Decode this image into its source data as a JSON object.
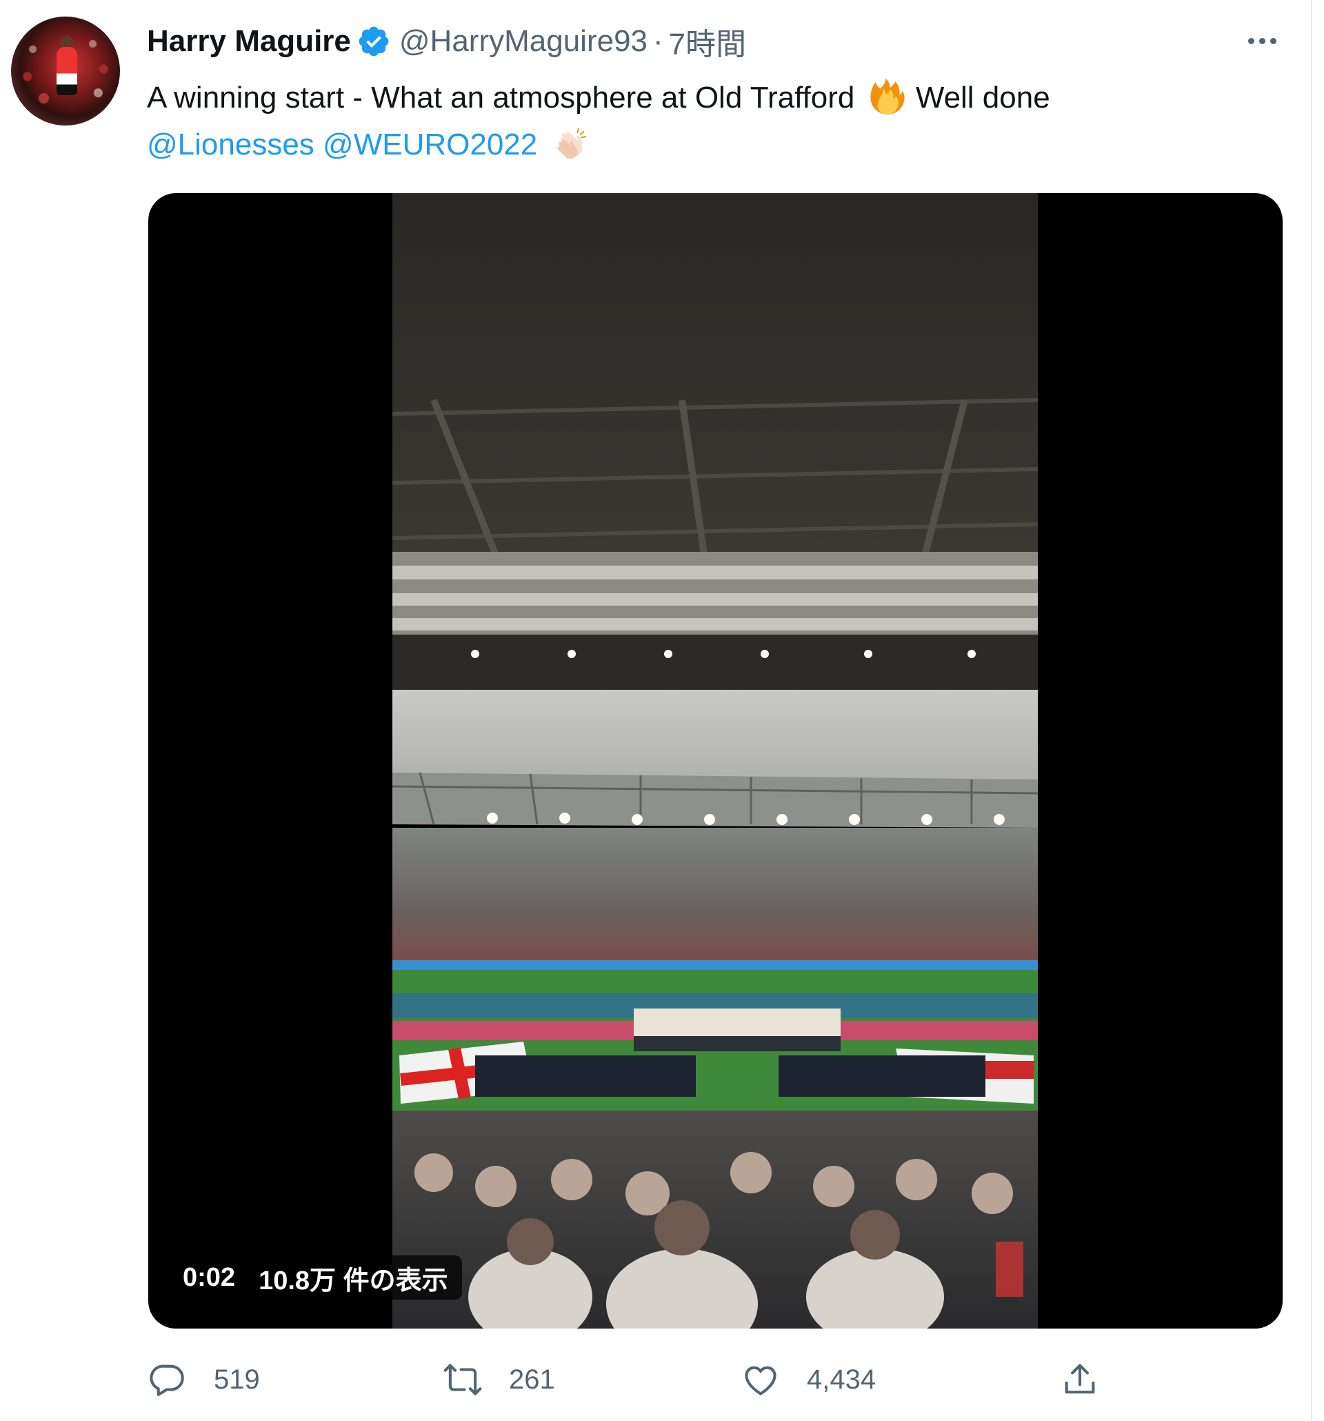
{
  "tweet": {
    "author_name": "Harry Maguire",
    "handle": "@HarryMaguire93",
    "separator": "·",
    "timestamp": "7時間",
    "text_line1": "A winning start - What an atmosphere at Old Trafford",
    "text_line1b": "Well done",
    "mention_1": "@Lionesses",
    "mention_2": "@WEURO2022",
    "emoji_1": "fire-emoji",
    "emoji_2": "clapping-hands-emoji"
  },
  "video": {
    "elapsed": "0:02",
    "views": "10.8万 件の表示"
  },
  "actions": {
    "replies": "519",
    "retweets": "261",
    "likes": "4,434"
  },
  "colors": {
    "accent": "#1d9bf0",
    "secondary_text": "#536471",
    "primary_text": "#0f1419"
  }
}
